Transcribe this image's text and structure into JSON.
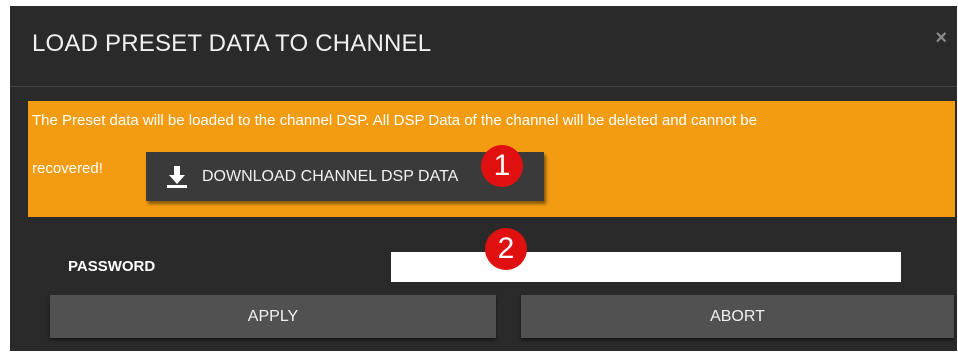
{
  "dialog": {
    "title": "LOAD PRESET DATA TO CHANNEL",
    "close_glyph": "×"
  },
  "warning": {
    "line1": "The Preset data will be loaded to the channel DSP. All DSP Data of the channel will be deleted and cannot be",
    "line2": "recovered!",
    "download_label": "DOWNLOAD CHANNEL DSP DATA",
    "download_icon": "download-icon",
    "background_color": "#f39c12"
  },
  "annotations": {
    "badge1": "1",
    "badge2": "2",
    "badge_color": "#e01010"
  },
  "form": {
    "password_label": "PASSWORD",
    "password_value": ""
  },
  "actions": {
    "apply_label": "APPLY",
    "abort_label": "ABORT"
  }
}
